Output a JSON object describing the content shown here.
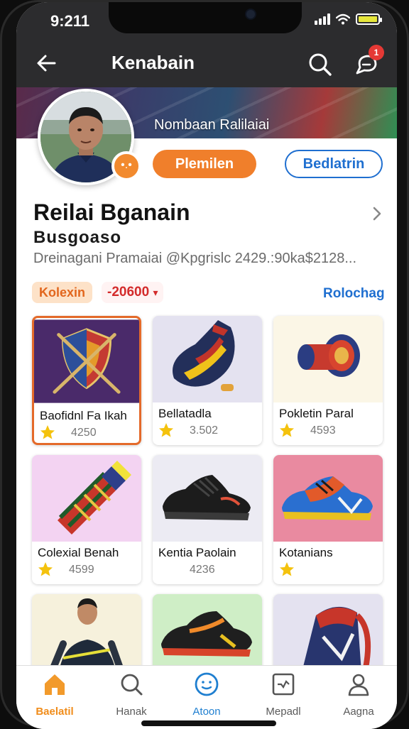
{
  "status_bar": {
    "time": "9:211"
  },
  "app_bar": {
    "title": "Kenabain",
    "notification_count": "1"
  },
  "banner": {
    "text": "Nombaan Ralilaiai"
  },
  "profile": {
    "badge_glyph": "•.•",
    "primary_button": "Plemilen",
    "secondary_button": "Bedlatrin",
    "name": "Reilai Bganain",
    "handle": "Busgoaso",
    "meta": "Dreinagani Pramaiai @Kpgrislc 2429.:90ka$2128..."
  },
  "filters": {
    "collection_chip": "Kolexin",
    "price_chip": "-20600",
    "price_arrow": "▾",
    "right_link": "Rolochag"
  },
  "products": [
    {
      "name": "Baofidnl Fa Ikah",
      "rating": "4250",
      "selected": true
    },
    {
      "name": "Bellatadla",
      "rating": "3.502",
      "selected": false
    },
    {
      "name": "Pokletin Paral",
      "rating": "4593",
      "selected": false
    },
    {
      "name": "Colexial Benah",
      "rating": "4599",
      "selected": false
    },
    {
      "name": "Kentia Paolain",
      "rating": "4236",
      "selected": false
    },
    {
      "name": "Kotanians",
      "rating": "",
      "selected": false
    }
  ],
  "bottom_nav": [
    {
      "label": "Baelatil",
      "icon": "home-icon",
      "active": true
    },
    {
      "label": "Hanak",
      "icon": "search-icon",
      "active": false
    },
    {
      "label": "Atoon",
      "icon": "smile-circle-icon",
      "active": false
    },
    {
      "label": "Mepadl",
      "icon": "inbox-icon",
      "active": false
    },
    {
      "label": "Aagna",
      "icon": "person-icon",
      "active": false
    }
  ],
  "colors": {
    "accent_orange": "#f07f2b",
    "accent_blue": "#1f6fd0",
    "price_red": "#d32b2b",
    "star_yellow": "#f4c20d"
  }
}
